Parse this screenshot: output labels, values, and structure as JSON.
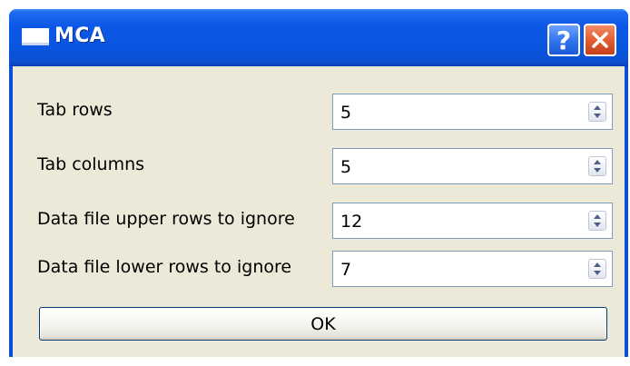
{
  "window": {
    "title": "MCA",
    "help_label": "?",
    "close_icon": "close-icon"
  },
  "form": {
    "rows": [
      {
        "label": "Tab rows",
        "value": "5"
      },
      {
        "label": "Tab columns",
        "value": "5"
      },
      {
        "label": "Data file upper rows to ignore",
        "value": "12"
      },
      {
        "label": "Data file lower rows to ignore",
        "value": "7"
      }
    ],
    "ok_label": "OK"
  },
  "colors": {
    "titlebar": "#0a56e0",
    "client_background": "#ece9d8",
    "close_button": "#e35a2c"
  }
}
